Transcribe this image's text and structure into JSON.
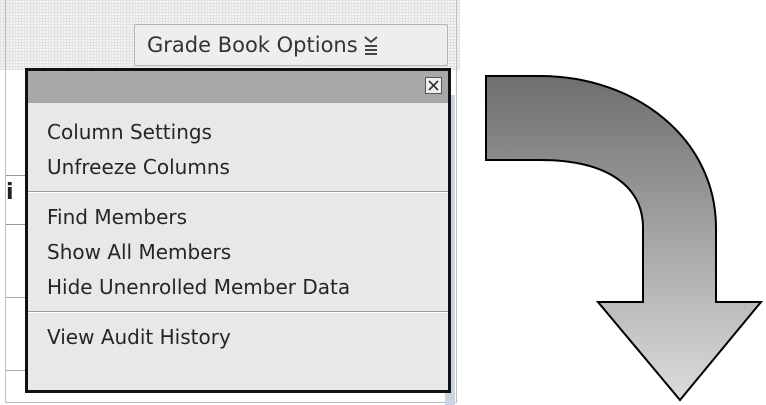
{
  "gradebook": {
    "options_button_label": "Grade Book Options",
    "options_icon": "chevron-stack-down-icon"
  },
  "background_fragment": {
    "partial_heading_char": "i"
  },
  "menu": {
    "close_icon": "close-icon",
    "groups": [
      {
        "items": [
          {
            "label": "Column Settings"
          },
          {
            "label": "Unfreeze Columns"
          }
        ]
      },
      {
        "items": [
          {
            "label": "Find Members"
          },
          {
            "label": "Show All Members"
          },
          {
            "label": "Hide Unenrolled Member Data"
          }
        ]
      },
      {
        "items": [
          {
            "label": "View Audit History"
          }
        ]
      }
    ]
  },
  "arrow": {
    "icon": "curved-arrow-down-icon",
    "colors": {
      "top": "#6e6e6e",
      "bottom": "#d9d9d9",
      "outline": "#000000"
    }
  },
  "colors": {
    "menu_header": "#a8a8a8",
    "menu_body": "#e8e8e8",
    "menu_border": "#111111",
    "button_bg": "#eeeeee"
  }
}
